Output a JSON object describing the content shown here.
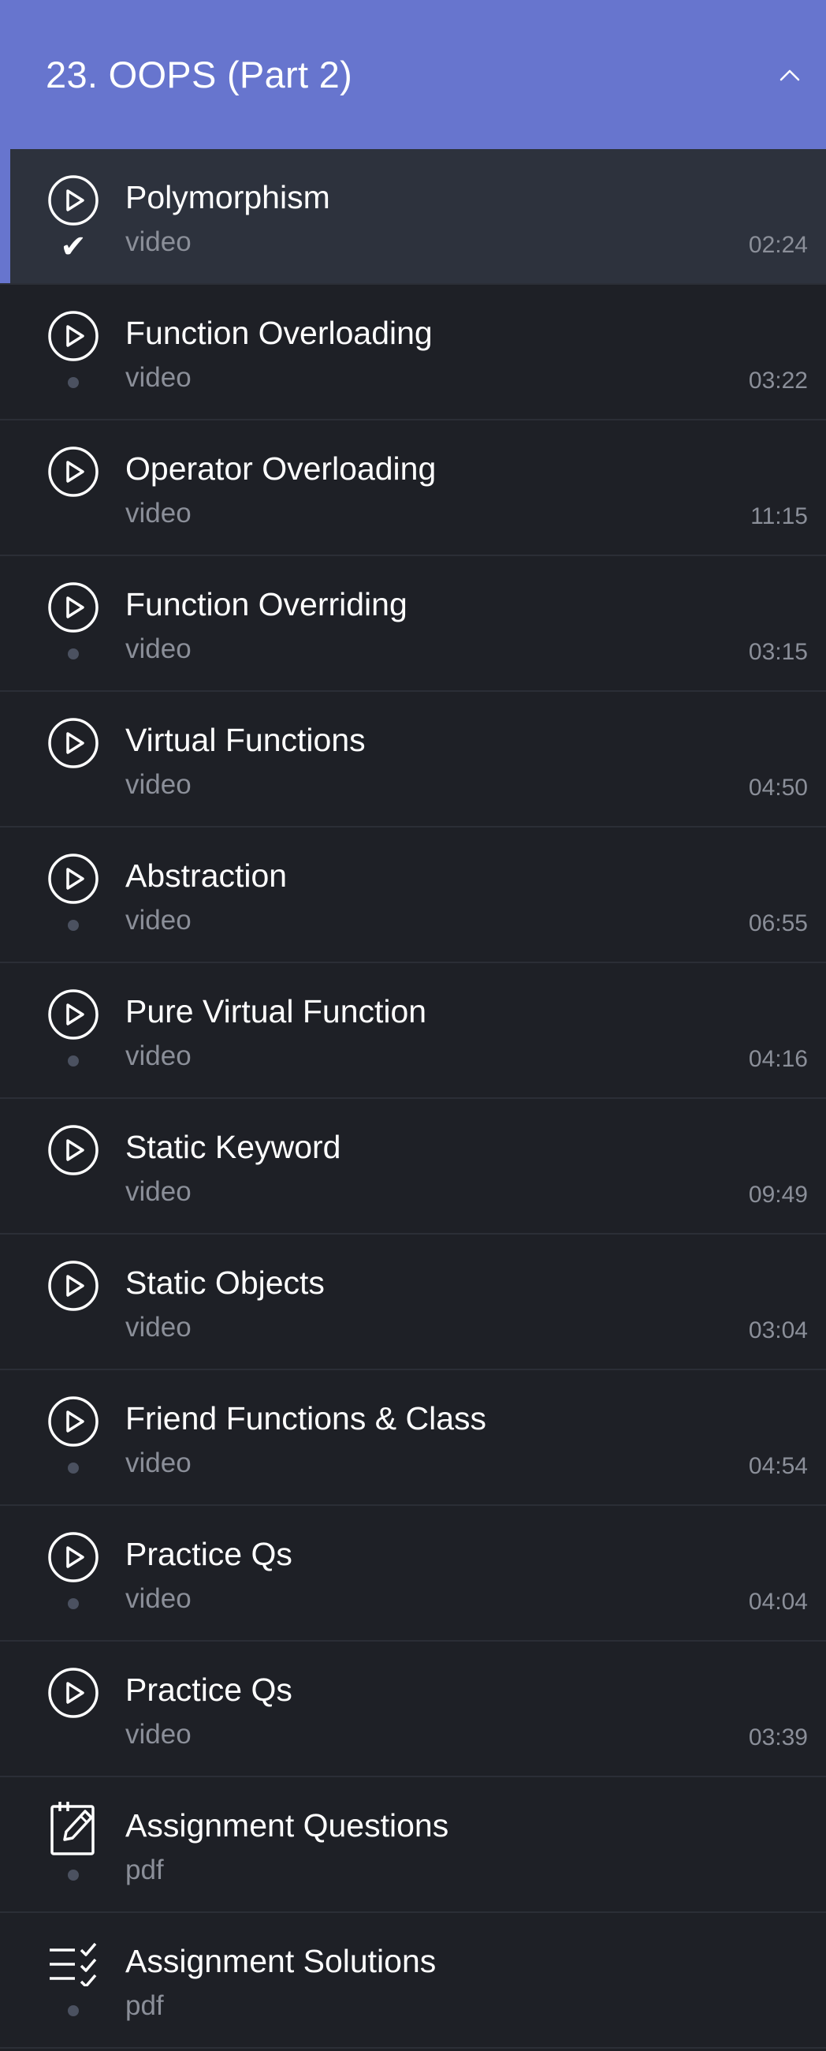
{
  "section": {
    "title": "23. OOPS (Part 2)",
    "collapse_icon": "chevron-up-icon",
    "accent_color": "#6775ce"
  },
  "lessons": [
    {
      "title": "Polymorphism",
      "type": "video",
      "duration": "02:24",
      "icon": "play-circle-icon",
      "status": "check",
      "active": true
    },
    {
      "title": "Function Overloading",
      "type": "video",
      "duration": "03:22",
      "icon": "play-circle-icon",
      "status": "dot",
      "active": false
    },
    {
      "title": "Operator Overloading",
      "type": "video",
      "duration": "11:15",
      "icon": "play-circle-icon",
      "status": "none",
      "active": false
    },
    {
      "title": "Function Overriding",
      "type": "video",
      "duration": "03:15",
      "icon": "play-circle-icon",
      "status": "dot",
      "active": false
    },
    {
      "title": "Virtual Functions",
      "type": "video",
      "duration": "04:50",
      "icon": "play-circle-icon",
      "status": "none",
      "active": false
    },
    {
      "title": "Abstraction",
      "type": "video",
      "duration": "06:55",
      "icon": "play-circle-icon",
      "status": "dot",
      "active": false
    },
    {
      "title": "Pure Virtual Function",
      "type": "video",
      "duration": "04:16",
      "icon": "play-circle-icon",
      "status": "dot",
      "active": false
    },
    {
      "title": "Static Keyword",
      "type": "video",
      "duration": "09:49",
      "icon": "play-circle-icon",
      "status": "none",
      "active": false
    },
    {
      "title": "Static Objects",
      "type": "video",
      "duration": "03:04",
      "icon": "play-circle-icon",
      "status": "none",
      "active": false
    },
    {
      "title": "Friend Functions & Class",
      "type": "video",
      "duration": "04:54",
      "icon": "play-circle-icon",
      "status": "dot",
      "active": false
    },
    {
      "title": "Practice Qs",
      "type": "video",
      "duration": "04:04",
      "icon": "play-circle-icon",
      "status": "dot",
      "active": false
    },
    {
      "title": "Practice Qs",
      "type": "video",
      "duration": "03:39",
      "icon": "play-circle-icon",
      "status": "none",
      "active": false
    },
    {
      "title": "Assignment Questions",
      "type": "pdf",
      "duration": "",
      "icon": "assignment-edit-icon",
      "status": "dot",
      "active": false
    },
    {
      "title": "Assignment Solutions",
      "type": "pdf",
      "duration": "",
      "icon": "checklist-icon",
      "status": "dot",
      "active": false
    }
  ]
}
